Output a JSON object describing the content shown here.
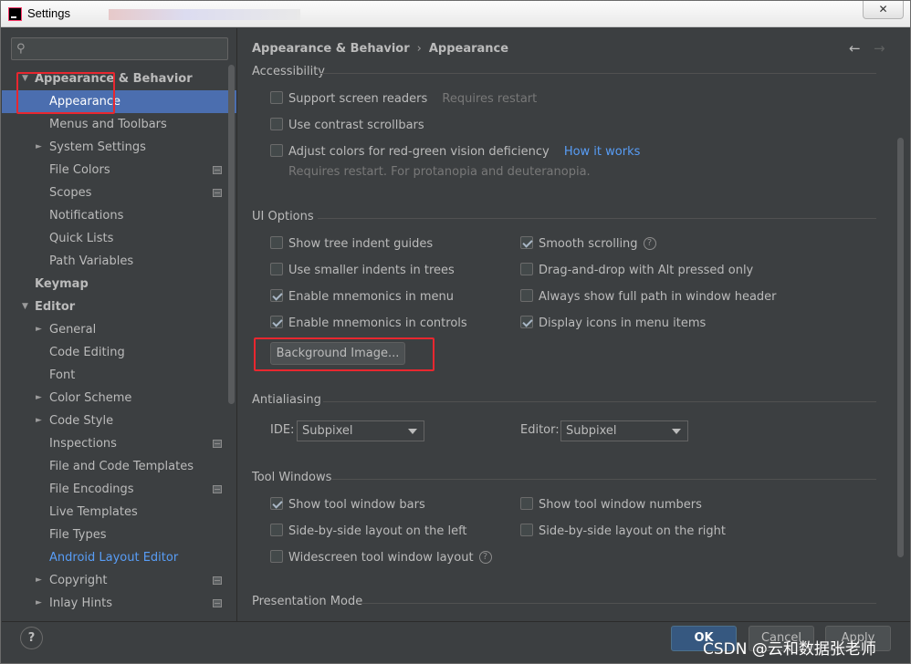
{
  "window": {
    "title": "Settings",
    "close_glyph": "✕"
  },
  "search": {
    "placeholder": "",
    "icon": "search-icon"
  },
  "tree": [
    {
      "label": "Appearance & Behavior",
      "expanded": true,
      "bold": true
    },
    {
      "label": "Appearance",
      "selected": true
    },
    {
      "label": "Menus and Toolbars"
    },
    {
      "label": "System Settings",
      "collapsed": true
    },
    {
      "label": "File Colors",
      "page_icon": true
    },
    {
      "label": "Scopes",
      "page_icon": true
    },
    {
      "label": "Notifications"
    },
    {
      "label": "Quick Lists"
    },
    {
      "label": "Path Variables"
    },
    {
      "label": "Keymap",
      "bold": true
    },
    {
      "label": "Editor",
      "expanded": true,
      "bold": true
    },
    {
      "label": "General",
      "collapsed": true
    },
    {
      "label": "Code Editing"
    },
    {
      "label": "Font"
    },
    {
      "label": "Color Scheme",
      "collapsed": true
    },
    {
      "label": "Code Style",
      "collapsed": true
    },
    {
      "label": "Inspections",
      "page_icon": true
    },
    {
      "label": "File and Code Templates"
    },
    {
      "label": "File Encodings",
      "page_icon": true
    },
    {
      "label": "Live Templates"
    },
    {
      "label": "File Types"
    },
    {
      "label": "Android Layout Editor",
      "highlight": true
    },
    {
      "label": "Copyright",
      "collapsed": true,
      "page_icon": true
    },
    {
      "label": "Inlay Hints",
      "collapsed": true,
      "page_icon": true
    }
  ],
  "breadcrumb": {
    "parent": "Appearance & Behavior",
    "separator": "›",
    "current": "Appearance",
    "back": "←",
    "forward": "→"
  },
  "accessibility": {
    "heading": "Accessibility",
    "screen_readers": {
      "label": "Support screen readers",
      "checked": false,
      "note": "Requires restart"
    },
    "contrast_scrollbars": {
      "label": "Use contrast scrollbars",
      "checked": false
    },
    "adjust_colors": {
      "label": "Adjust colors for red-green vision deficiency",
      "checked": false,
      "link": "How it works",
      "note": "Requires restart. For protanopia and deuteranopia."
    }
  },
  "ui_options": {
    "heading": "UI Options",
    "tree_indent": {
      "label": "Show tree indent guides",
      "checked": false
    },
    "smaller_indents": {
      "label": "Use smaller indents in trees",
      "checked": false
    },
    "mnemonics_menu": {
      "label": "Enable mnemonics in menu",
      "checked": true
    },
    "mnemonics_controls": {
      "label": "Enable mnemonics in controls",
      "checked": true
    },
    "smooth_scrolling": {
      "label": "Smooth scrolling",
      "checked": true,
      "help": "?"
    },
    "drag_drop": {
      "label": "Drag-and-drop with Alt pressed only",
      "checked": false
    },
    "full_path": {
      "label": "Always show full path in window header",
      "checked": false
    },
    "menu_icons": {
      "label": "Display icons in menu items",
      "checked": true
    },
    "background_button": "Background Image..."
  },
  "antialiasing": {
    "heading": "Antialiasing",
    "ide_label": "IDE:",
    "ide_value": "Subpixel",
    "editor_label": "Editor:",
    "editor_value": "Subpixel"
  },
  "tool_windows": {
    "heading": "Tool Windows",
    "bars": {
      "label": "Show tool window bars",
      "checked": true
    },
    "numbers": {
      "label": "Show tool window numbers",
      "checked": false
    },
    "side_left": {
      "label": "Side-by-side layout on the left",
      "checked": false
    },
    "side_right": {
      "label": "Side-by-side layout on the right",
      "checked": false
    },
    "widescreen": {
      "label": "Widescreen tool window layout",
      "checked": false,
      "help": "?"
    }
  },
  "presentation": {
    "heading": "Presentation Mode"
  },
  "footer": {
    "help": "?",
    "ok": "OK",
    "cancel": "Cancel",
    "apply": "Apply"
  },
  "watermark": "CSDN @云和数据张老师",
  "colors": {
    "selection": "#4b6eaf",
    "link": "#589df6",
    "annotation": "#e8272f",
    "background": "#3c3f41"
  }
}
